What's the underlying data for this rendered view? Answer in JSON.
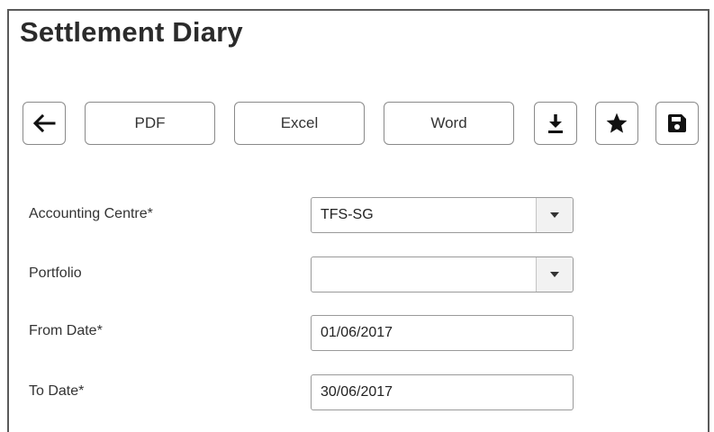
{
  "page": {
    "title": "Settlement Diary"
  },
  "toolbar": {
    "back_icon": "arrow-left-icon",
    "pdf_label": "PDF",
    "excel_label": "Excel",
    "word_label": "Word",
    "download_icon": "download-icon",
    "favorite_icon": "star-icon",
    "save_icon": "floppy-disk-icon"
  },
  "form": {
    "accounting_centre": {
      "label": "Accounting Centre*",
      "value": "TFS-SG"
    },
    "portfolio": {
      "label": "Portfolio",
      "value": ""
    },
    "from_date": {
      "label": "From Date*",
      "value": "01/06/2017"
    },
    "to_date": {
      "label": "To Date*",
      "value": "30/06/2017"
    }
  }
}
